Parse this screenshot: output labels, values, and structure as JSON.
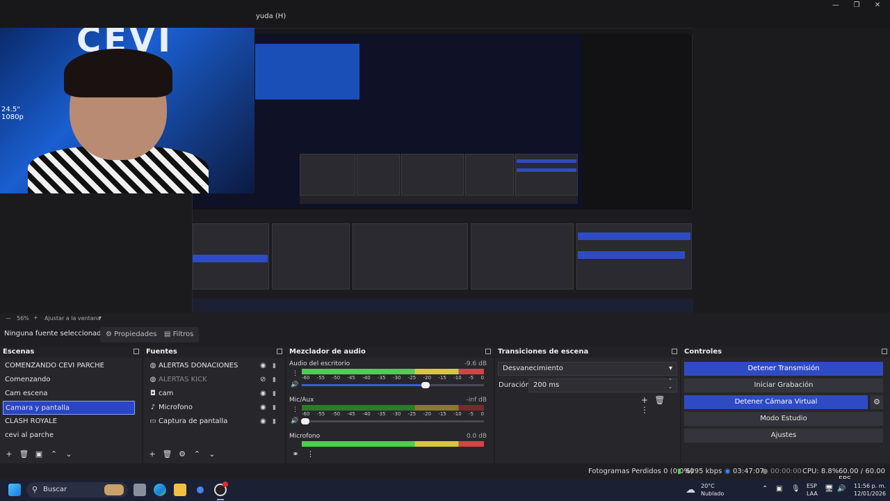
{
  "titlebar": {
    "menu_help": "yuda (H)"
  },
  "preview": {
    "overlay_text": "CEVI",
    "monitor_text": "24.5\"\n1080p"
  },
  "zoombar": {
    "zoom": "56%",
    "fit_label": "Ajustar a la ventana"
  },
  "source_toolbar": {
    "no_source": "Ninguna fuente seleccionad",
    "properties": "Propiedades",
    "filters": "Filtros"
  },
  "scenes": {
    "title": "Escenas",
    "items": [
      "COMENZANDO CEVI PARCHE",
      "Comenzando",
      "Cam escena",
      "Camara y pantalla",
      "CLASH ROYALE",
      "cevi al parche"
    ],
    "selected_index": 3
  },
  "sources": {
    "title": "Fuentes",
    "items": [
      {
        "name": "ALERTAS DONACIONES",
        "icon": "globe-icon",
        "visible": true
      },
      {
        "name": "ALERTAS KICK",
        "icon": "globe-icon",
        "visible": false
      },
      {
        "name": "cam",
        "icon": "camera-icon",
        "visible": true
      },
      {
        "name": "Microfono",
        "icon": "microphone-icon",
        "visible": true
      },
      {
        "name": "Captura de pantalla",
        "icon": "monitor-icon",
        "visible": true
      }
    ]
  },
  "mixer": {
    "title": "Mezclador de audio",
    "ticks": [
      "-60",
      "-55",
      "-50",
      "-45",
      "-40",
      "-35",
      "-30",
      "-25",
      "-20",
      "-15",
      "-10",
      "-5",
      "0"
    ],
    "channels": [
      {
        "name": "Audio del escritorio",
        "db": "-9.6 dB",
        "volume": 0.68,
        "muted": false
      },
      {
        "name": "Mic/Aux",
        "db": "-inf dB",
        "volume": 0.02,
        "muted": true
      },
      {
        "name": "Microfono",
        "db": "0.0 dB",
        "volume": 1.0,
        "muted": false
      }
    ]
  },
  "transitions": {
    "title": "Transiciones de escena",
    "type": "Desvanecimiento",
    "duration_label": "Duración",
    "duration": "200 ms"
  },
  "controls": {
    "title": "Controles",
    "buttons": [
      "Detener Transmisión",
      "Iniciar Grabación",
      "Detener Cámara Virtual",
      "Modo Estudio",
      "Ajustes"
    ]
  },
  "statusbar": {
    "dropped": "Fotogramas Perdidos 0 (0.0%)",
    "bitrate": "6095 kbps",
    "stream_time": "03:47:07",
    "rec_time": "00:00:00",
    "cpu": "CPU: 8.8%",
    "fps": "60.00 / 60.00 FPS"
  },
  "taskbar": {
    "search": "Buscar",
    "weather_temp": "20°C",
    "weather_desc": "Nublado",
    "lang1": "ESP",
    "lang2": "LAA",
    "time": "11:56 p. m.",
    "date": "12/01/2026"
  }
}
